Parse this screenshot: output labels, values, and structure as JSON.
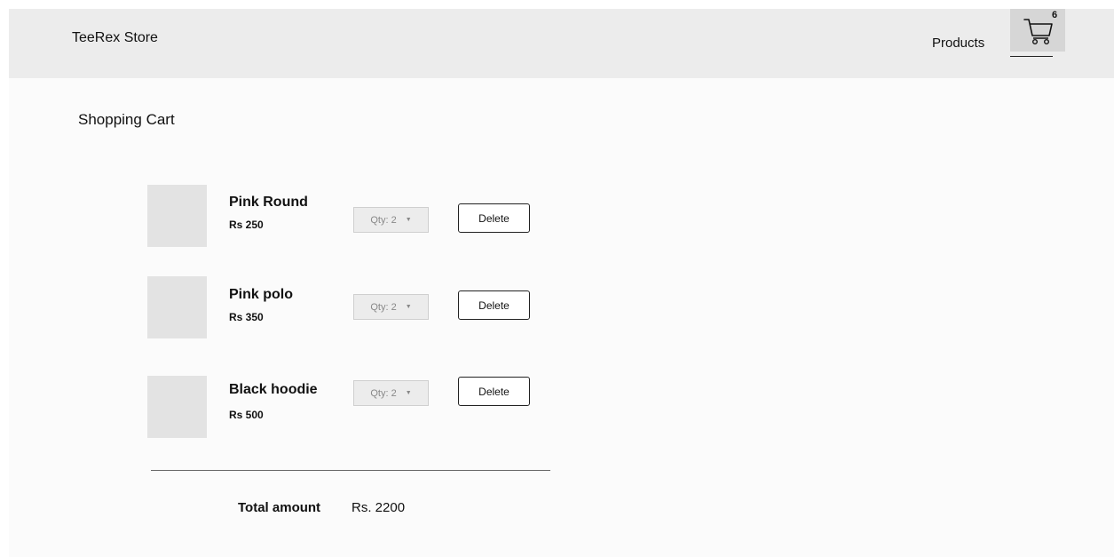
{
  "header": {
    "brand": "TeeRex Store",
    "nav_products": "Products",
    "cart_count": "6",
    "cart_icon": "shopping-cart-icon"
  },
  "page": {
    "title": "Shopping Cart"
  },
  "cart": {
    "items": [
      {
        "name": "Pink Round",
        "price": "Rs 250",
        "qty": "Qty: 2",
        "delete_label": "Delete"
      },
      {
        "name": "Pink polo",
        "price": "Rs 350",
        "qty": "Qty: 2",
        "delete_label": "Delete"
      },
      {
        "name": "Black hoodie",
        "price": "Rs 500",
        "qty": "Qty: 2",
        "delete_label": "Delete"
      }
    ],
    "total_label": "Total amount",
    "total_value": "Rs. 2200"
  },
  "colors": {
    "header_bg": "#ececec",
    "cart_button_bg": "#d6d6d6",
    "thumbnail_bg": "#e3e3e3"
  }
}
